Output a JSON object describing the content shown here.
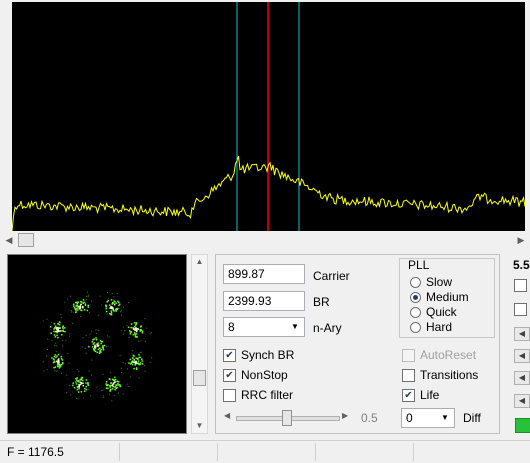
{
  "spectrum": {
    "trace_color": "#ffff00",
    "marker_center_color": "#ff0000",
    "marker_side_color": "#00c8c8"
  },
  "controls": {
    "carrier_value": "899.87",
    "carrier_label": "Carrier",
    "br_value": "2399.93",
    "br_label": "BR",
    "nary_value": "8",
    "nary_label": "n-Ary",
    "synch_br_label": "Synch BR",
    "synch_br_checked": true,
    "nonstop_label": "NonStop",
    "nonstop_checked": true,
    "rrc_label": "RRC filter",
    "rrc_checked": false,
    "slider_value_label": "0.5",
    "slider_level": 0.5,
    "autoreset_label": "AutoReset",
    "transitions_label": "Transitions",
    "life_label": "Life",
    "diff_value": "0",
    "diff_label": "Diff"
  },
  "pll": {
    "title": "PLL",
    "options": [
      "Slow",
      "Medium",
      "Quick",
      "Hard"
    ],
    "selected": "Medium"
  },
  "side": {
    "value_label": "5.5"
  },
  "constellation": {
    "point_color": "#66ff22"
  },
  "status": {
    "frequency": "F = 1176.5"
  }
}
